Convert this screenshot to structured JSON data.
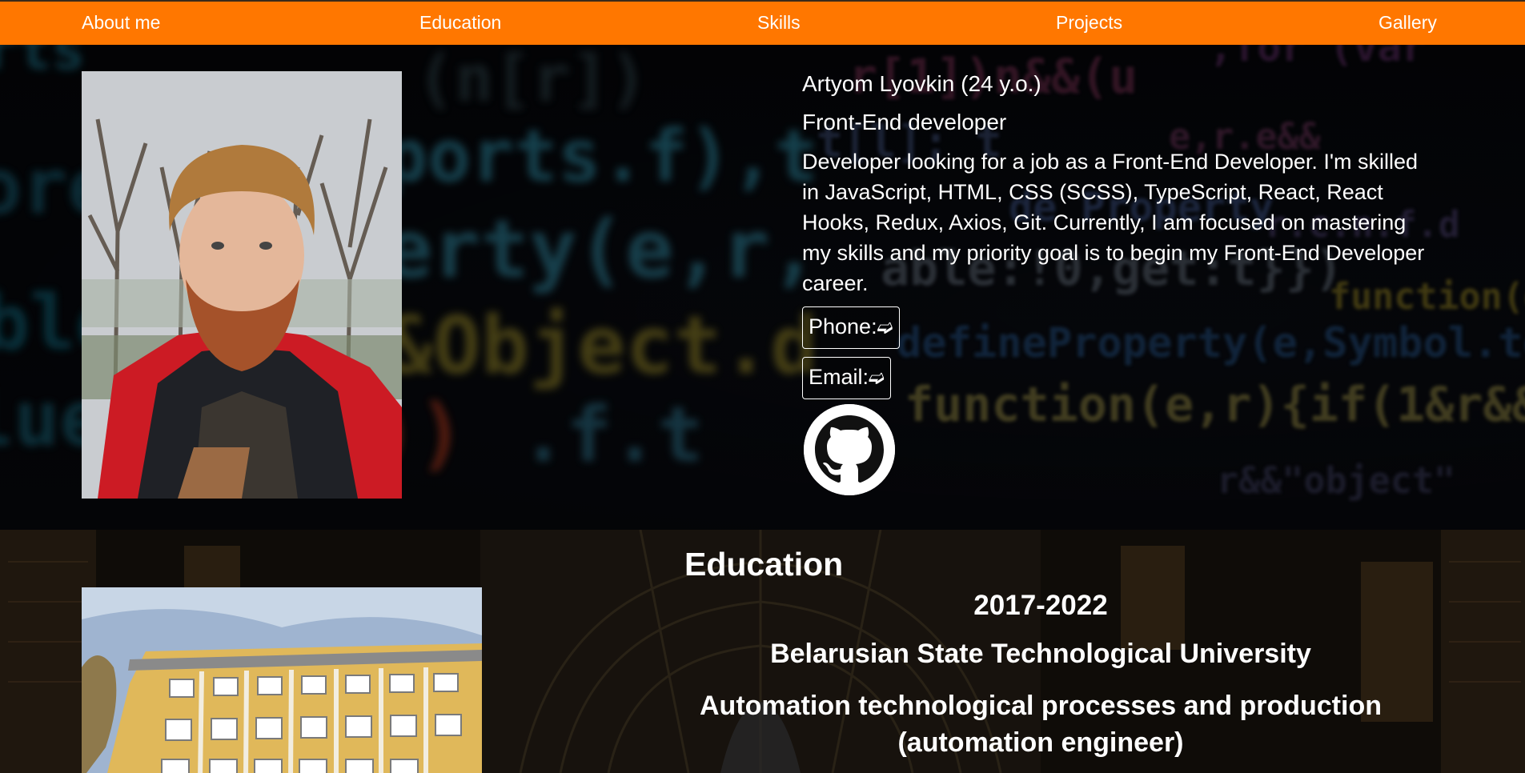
{
  "nav": {
    "items": [
      "About me",
      "Education",
      "Skills",
      "Projects",
      "Gallery"
    ]
  },
  "hero": {
    "name": "Artyom Lyovkin (24 y.o.)",
    "role": "Front-End developer",
    "about": "Developer looking for a job as a Front-End Developer. I'm skilled in JavaScript, HTML, CSS (SCSS), TypeScript, React, React Hooks, Redux, Axios, Git. Currently, I am focused on mastering my skills and my priority goal is to begin my Front-End Developer career.",
    "phone_label": "Phone:",
    "email_label": "Email:",
    "arrow": "➫",
    "github_icon": "github-icon"
  },
  "education": {
    "title": "Education",
    "years": "2017-2022",
    "university": "Belarusian State Technological University",
    "speciality": "Automation technological processes and production (automation engineer)"
  },
  "colors": {
    "nav_bg": "#ff7700",
    "text": "#ffffff"
  }
}
